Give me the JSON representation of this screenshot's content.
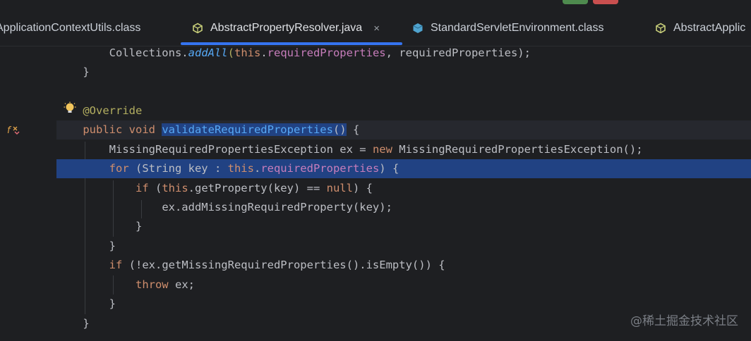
{
  "tabs": [
    {
      "label": "ApplicationContextUtils.class",
      "icon": "class-file-icon",
      "active": false
    },
    {
      "label": "AbstractPropertyResolver.java",
      "icon": "abstract-class-icon",
      "active": true,
      "close": "×"
    },
    {
      "label": "StandardServletEnvironment.class",
      "icon": "class-file-icon",
      "active": false
    },
    {
      "label": "AbstractApplic",
      "icon": "abstract-class-icon",
      "active": false
    }
  ],
  "code": {
    "l1": {
      "t1": "Collections.",
      "t2": "addAll",
      "t3": "(",
      "t4": "this",
      "t5": ".",
      "t6": "requiredProperties",
      "t7": ", requiredProperties);"
    },
    "l2": {
      "t1": "}"
    },
    "l3": {
      "t1": "@Override"
    },
    "l4": {
      "t1": "public void ",
      "t2": "validateRequiredProperties",
      "t3": "()",
      "t4": " {"
    },
    "l5": {
      "t1": "MissingRequiredPropertiesException ex = ",
      "t2": "new",
      "t3": " MissingRequiredPropertiesException();"
    },
    "l6": {
      "t1": "for",
      "t2": " (String key : ",
      "t3": "this",
      "t4": ".",
      "t5": "requiredProperties",
      "t6": ") {"
    },
    "l7": {
      "t1": "if",
      "t2": " (",
      "t3": "this",
      "t4": ".getProperty(key) == ",
      "t5": "null",
      "t6": ") {"
    },
    "l8": {
      "t1": "ex.addMissingRequiredProperty(key);"
    },
    "l9": {
      "t1": "}"
    },
    "l10": {
      "t1": "}"
    },
    "l11": {
      "t1": "if",
      "t2": " (!ex.getMissingRequiredProperties().isEmpty()) {"
    },
    "l12": {
      "t1": "throw",
      "t2": " ex;"
    },
    "l13": {
      "t1": "}"
    },
    "l14": {
      "t1": "}"
    }
  },
  "gutter_icons": {
    "intention": "lightbulb-icon",
    "override_marker": "override-method-icon"
  },
  "watermark": "@稀土掘金技术社区",
  "colors": {
    "accent": "#3574f0",
    "keyword": "#cf8e6d",
    "function": "#56a8f5",
    "field": "#c77dbb",
    "annotation": "#b3ae60",
    "selection": "#214283"
  }
}
